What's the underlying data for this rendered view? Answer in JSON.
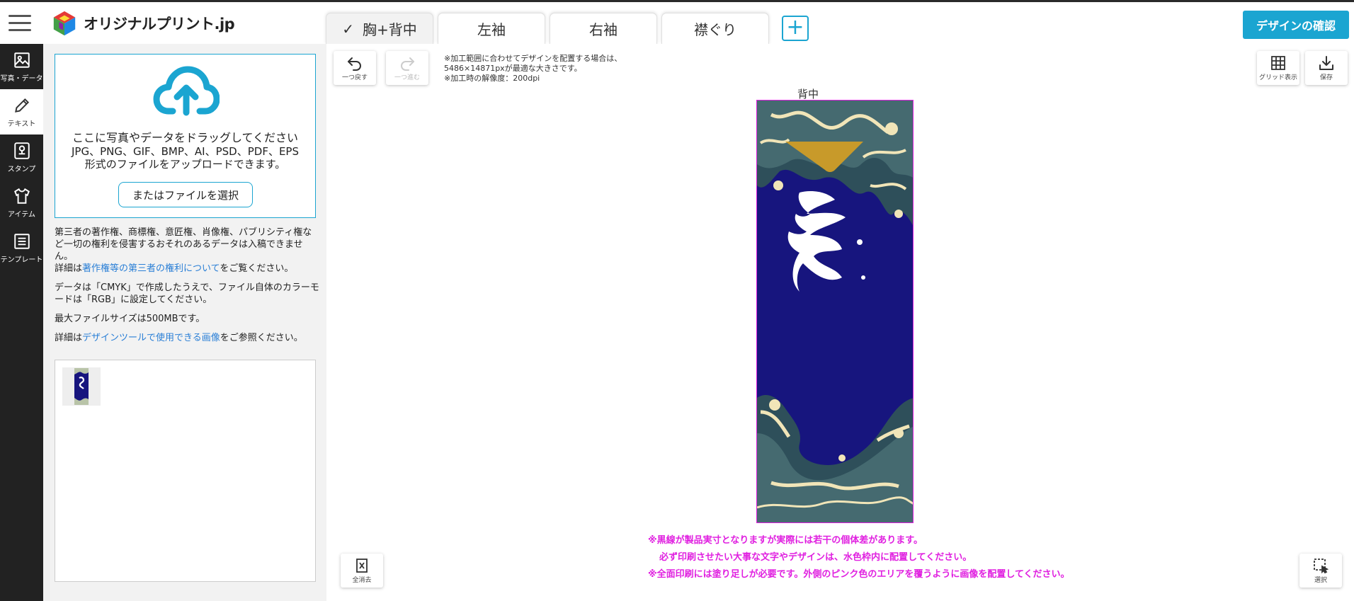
{
  "header": {
    "logo_text": "オリジナルプリント.jp",
    "tabs": [
      {
        "label": "胸+背中",
        "active": true
      },
      {
        "label": "左袖",
        "active": false
      },
      {
        "label": "右袖",
        "active": false
      },
      {
        "label": "襟ぐり",
        "active": false
      }
    ],
    "add_tab_label": "+",
    "confirm_label": "デザインの確認"
  },
  "rail": {
    "items": [
      {
        "label": "写真・データ",
        "icon": "image-icon",
        "active": false
      },
      {
        "label": "テキスト",
        "icon": "pencil-icon",
        "active": true
      },
      {
        "label": "スタンプ",
        "icon": "stamp-icon",
        "active": false
      },
      {
        "label": "アイテム",
        "icon": "tshirt-icon",
        "active": false
      },
      {
        "label": "テンプレート",
        "icon": "template-icon",
        "active": false
      }
    ]
  },
  "panel": {
    "upload_title": "ここに写真やデータをドラッグしてください",
    "upload_formats_line1": "JPG、PNG、GIF、BMP、AI、PSD、PDF、EPS",
    "upload_formats_line2": "形式のファイルをアップロードできます。",
    "file_button": "またはファイルを選択",
    "note1": "第三者の著作権、商標権、意匠権、肖像権、パブリシティ権など一切の権利を侵害するおそれのあるデータは入稿できません。",
    "note2_prefix": "詳細は",
    "note2_link": "著作権等の第三者の権利について",
    "note2_suffix": "をご覧ください。",
    "note3": "データは「CMYK」で作成したうえで、ファイル自体のカラーモードは「RGB」に設定してください。",
    "note4": "最大ファイルサイズは500MBです。",
    "note5_prefix": "詳細は",
    "note5_link": "デザインツールで使用できる画像",
    "note5_suffix": "をご参照ください。"
  },
  "canvas": {
    "undo_label": "一つ戻す",
    "redo_label": "一つ進む",
    "grid_label": "グリッド表示",
    "save_label": "保存",
    "clear_label": "全消去",
    "select_label": "選択",
    "hint_line1": "※加工範囲に合わせてデザインを配置する場合は、",
    "hint_line2": "5486×14871pxが最適な大きさです。",
    "hint_line3": "※加工時の解像度：200dpi",
    "area_label": "背中",
    "warn_line1": "※黒線が製品実寸となりますが実際には若干の個体差があります。",
    "warn_line2": "必ず印刷させたい大事な文字やデザインは、水色枠内に配置してください。",
    "warn_line3": "※全面印刷には塗り足しが必要です。外側のピンク色のエリアを覆うように画像を配置してください。"
  },
  "colors": {
    "accent": "#1ba5d1",
    "rail_bg": "#222222",
    "warning": "#e020e0",
    "design_navy": "#17157e"
  }
}
